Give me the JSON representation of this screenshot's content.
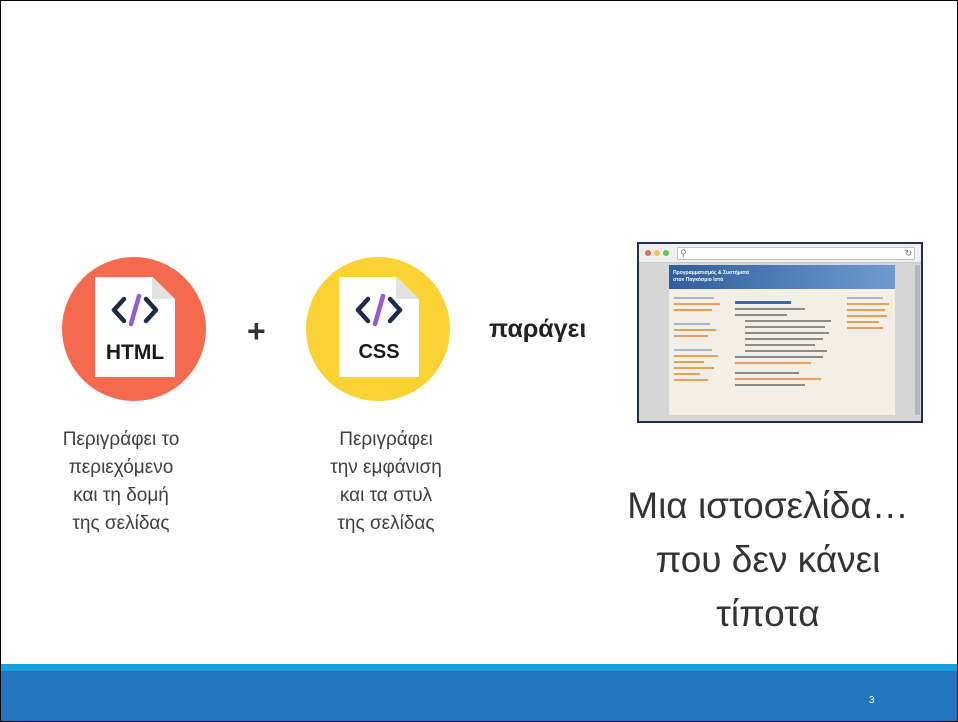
{
  "slide": {
    "html_badge": {
      "label": "HTML",
      "icon": "code-icon",
      "color": "#F46A4E"
    },
    "plus": "+",
    "css_badge": {
      "label": "CSS",
      "icon": "code-icon",
      "color": "#FBD233"
    },
    "produces": "παράγει",
    "html_description": [
      "Περιγράφει το",
      "περιεχόμενο",
      "και τη δομή",
      "της σελίδας"
    ],
    "css_description": [
      "Περιγράφει",
      "την εμφάνιση",
      "και τα στυλ",
      "της σελίδας"
    ],
    "caption": [
      "Μια ιστοσελίδα…",
      "που δεν κάνει",
      "τίποτα"
    ],
    "screenshot": {
      "site_title_line1": "Προγραμματισμός & Συστήματα",
      "site_title_line2": "στον Παγκόσμιο Ιστό"
    },
    "page_number": "3"
  },
  "colors": {
    "accent_bar": "#2275BE",
    "accent_strip": "#17A2DC",
    "code_icon_purple": "#9B59D0",
    "code_icon_navy": "#1E2A4A"
  }
}
